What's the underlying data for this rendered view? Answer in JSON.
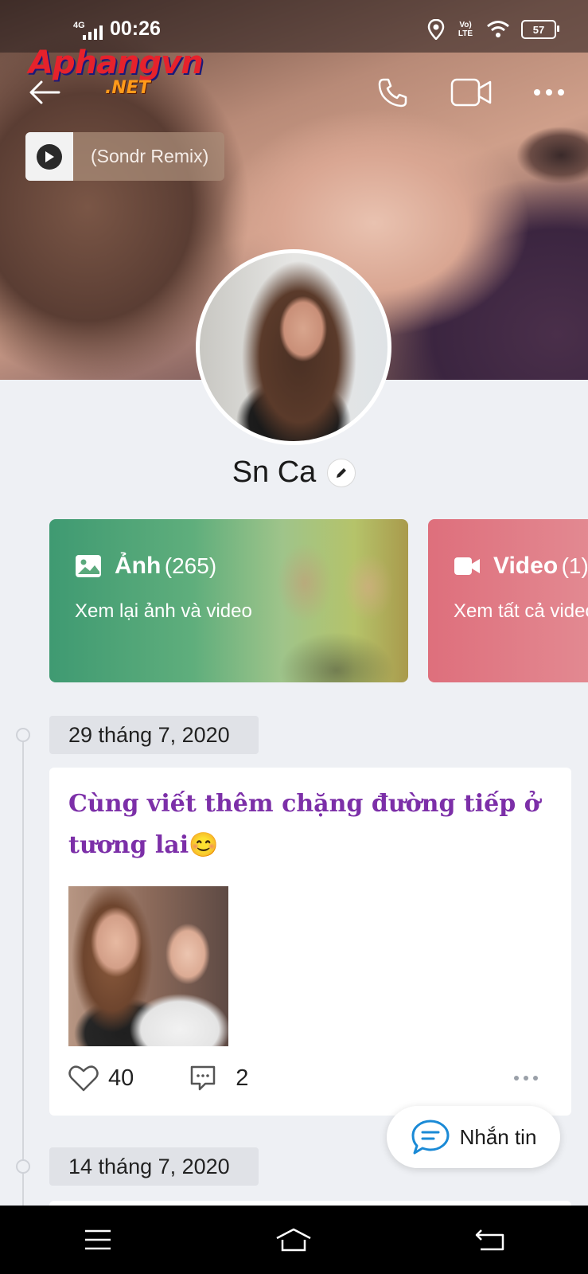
{
  "status_bar": {
    "network": "4G",
    "time": "00:26",
    "volte": "Vo) LTE",
    "battery": "57"
  },
  "watermark": {
    "main": "Aphangvn",
    "sub": ".NET"
  },
  "header": {
    "back_icon": "arrow-left-icon",
    "call_icon": "phone-icon",
    "video_icon": "video-camera-icon",
    "more_icon": "more-horizontal-icon"
  },
  "music": {
    "title": "(Sondr Remix)"
  },
  "profile": {
    "name": "Sn Ca"
  },
  "cards": {
    "photos": {
      "title": "Ảnh",
      "count": "(265)",
      "subtitle": "Xem lại ảnh và video"
    },
    "videos": {
      "title": "Video",
      "count": "(1)",
      "subtitle": "Xem tất cả video"
    }
  },
  "timeline": {
    "groups": [
      {
        "date": "29 tháng 7, 2020",
        "post": {
          "text": "Cùng viết thêm chặng đường tiếp ở tương lai😊",
          "likes": "40",
          "comments": "2"
        }
      },
      {
        "date": "14 tháng 7, 2020"
      }
    ]
  },
  "message_button": {
    "label": "Nhắn tin"
  },
  "colors": {
    "accent": "#1a8ad6",
    "post_text": "#7c2fa8",
    "photos_card": "#3f9a72",
    "video_card": "#de6f7c"
  }
}
